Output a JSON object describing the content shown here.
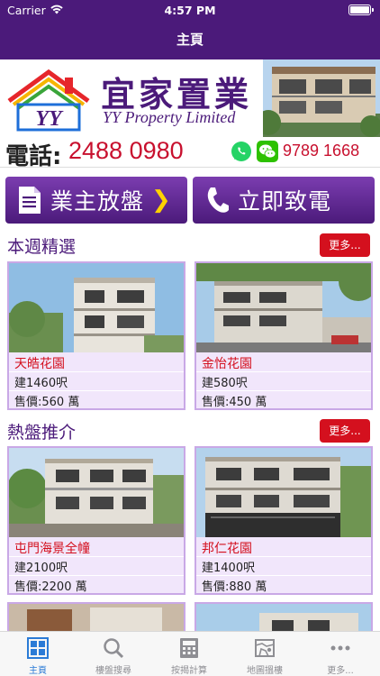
{
  "status_bar": {
    "carrier": "Carrier",
    "time": "4:57 PM"
  },
  "nav": {
    "title": "主頁"
  },
  "brand": {
    "name_cn": "宜家置業",
    "name_en": "YY Property Limited",
    "logo_letters": "YY"
  },
  "contact": {
    "phone_label": "電話:",
    "phone_number": "2488 0980",
    "alt_number": "9789 1668"
  },
  "actions": {
    "list_property": "業主放盤",
    "call_now": "立即致電"
  },
  "sections": [
    {
      "title": "本週精選",
      "more_label": "更多...",
      "items": [
        {
          "name": "天皓花園",
          "area": "建1460呎",
          "price": "售價:560 萬"
        },
        {
          "name": "金怡花園",
          "area": "建580呎",
          "price": "售價:450 萬"
        }
      ]
    },
    {
      "title": "熱盤推介",
      "more_label": "更多...",
      "items": [
        {
          "name": "屯門海景全幢",
          "area": "建2100呎",
          "price": "售價:2200 萬"
        },
        {
          "name": "邦仁花園",
          "area": "建1400呎",
          "price": "售價:880 萬"
        }
      ]
    }
  ],
  "tabs": [
    {
      "label": "主頁",
      "icon": "home-grid-icon",
      "active": true
    },
    {
      "label": "樓盤搜尋",
      "icon": "search-icon",
      "active": false
    },
    {
      "label": "按揭計算",
      "icon": "calculator-icon",
      "active": false
    },
    {
      "label": "地圖搵樓",
      "icon": "map-icon",
      "active": false
    },
    {
      "label": "更多...",
      "icon": "more-icon",
      "active": false
    }
  ],
  "colors": {
    "primary": "#4b1a7a",
    "accent_red": "#d4101e",
    "tab_active": "#2b7bd6"
  }
}
